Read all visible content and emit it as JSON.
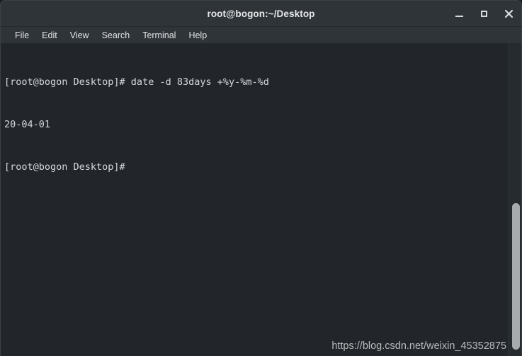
{
  "window": {
    "title": "root@bogon:~/Desktop",
    "controls": {
      "minimize_label": "_",
      "maximize_label": "□",
      "close_label": "✕"
    },
    "colors": {
      "titlebar_bg": "#2f3438",
      "menubar_bg": "#2f3438",
      "terminal_bg": "#22262a",
      "terminal_fg": "#d6d9dc",
      "scrollbar_thumb": "#a8abad",
      "watermark_fg": "#b9bcbe"
    }
  },
  "menubar": {
    "items": [
      {
        "label": "File"
      },
      {
        "label": "Edit"
      },
      {
        "label": "View"
      },
      {
        "label": "Search"
      },
      {
        "label": "Terminal"
      },
      {
        "label": "Help"
      }
    ]
  },
  "terminal": {
    "lines": [
      "[root@bogon Desktop]# date -d 83days +%y-%m-%d",
      "20-04-01",
      "[root@bogon Desktop]#"
    ]
  },
  "watermark": {
    "text": "https://blog.csdn.net/weixin_45352875"
  }
}
